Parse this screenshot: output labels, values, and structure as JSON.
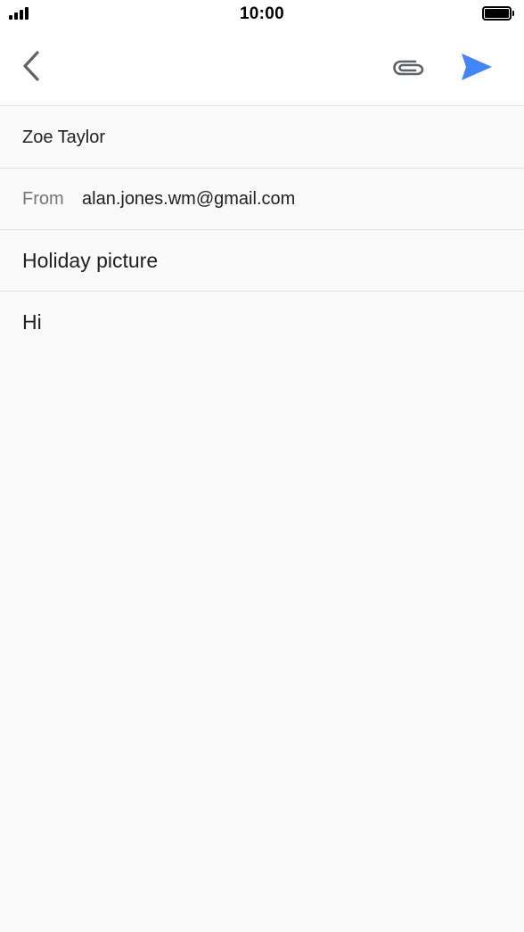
{
  "status_bar": {
    "time": "10:00",
    "icons": [
      "signal-icon",
      "battery-icon"
    ]
  },
  "toolbar": {
    "icons": [
      "back-arrow-icon",
      "paperclip-icon",
      "send-icon"
    ],
    "send_color": "#4285f4",
    "icon_color": "#5f6368"
  },
  "compose": {
    "to": "Zoe Taylor",
    "from_label": "From",
    "from_value": "alan.jones.wm@gmail.com",
    "subject": "Holiday picture",
    "body": "Hi"
  }
}
